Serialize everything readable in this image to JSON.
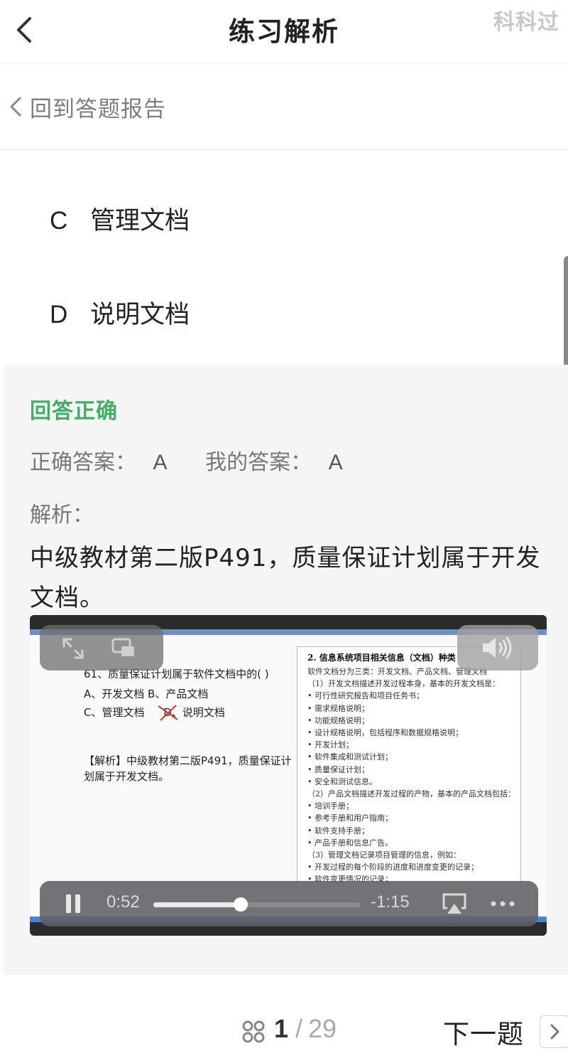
{
  "header": {
    "title": "练习解析",
    "watermark": "科科过"
  },
  "report_link": {
    "label": "回到答题报告"
  },
  "options": [
    {
      "letter": "C",
      "text": "管理文档"
    },
    {
      "letter": "D",
      "text": "说明文档"
    }
  ],
  "result": {
    "status": "回答正确",
    "correct_label": "正确答案：",
    "correct_value": "A",
    "mine_label": "我的答案：",
    "mine_value": "A",
    "analysis_label": "解析：",
    "analysis_text": "中级教材第二版P491，质量保证计划属于开发文档。"
  },
  "video": {
    "current_time": "0:52",
    "remaining_time": "-1:15",
    "progress": 0.42,
    "frame": {
      "question": "61、质量保证计划属于软件文档中的(   )",
      "opt_ab": "A、开发文档      B、产品文档",
      "opt_c": "C、管理文档",
      "opt_d": "D、说明文档",
      "analysis": "【解析】中级教材第二版P491，质量保证计划属于开发文档。",
      "doc_title": "2. 信息系统项目相关信息（文档）种类",
      "doc_lines": [
        "软件文档分为三类：开发文档、产品文档、管理文档",
        "（1）开发文档描述开发过程本身，基本的开发文档是：",
        "• 可行性研究报告和项目任务书；",
        "• 需求规格说明；",
        "• 功能规格说明；",
        "• 设计规格说明，包括程序和数据规格说明；",
        "• 开发计划；",
        "• 软件集成和测试计划；",
        "• 质量保证计划；",
        "• 安全和测试信息。",
        "（2）产品文档描述开发过程的产物，基本的产品文档包括：",
        "• 培训手册；",
        "• 参考手册和用户指南；",
        "• 软件支持手册；",
        "• 产品手册和信息广告。",
        "（3）管理文档记录项目管理的信息，例如：",
        "• 开发过程的每个阶段的进度和进度变更的记录；",
        "• 软件变更情况的记录；"
      ]
    }
  },
  "footer": {
    "current_page": "1",
    "separator": "/",
    "total_pages": "29",
    "next_label": "下一题"
  }
}
